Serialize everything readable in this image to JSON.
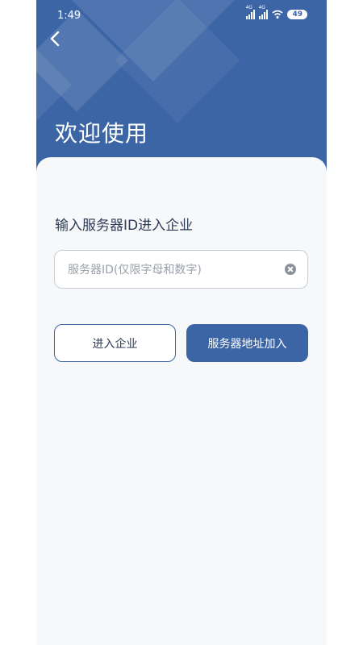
{
  "status_bar": {
    "time": "1:49",
    "sim1_type": "4G",
    "sim2_type": "4G",
    "battery": "49"
  },
  "header": {
    "title": "欢迎使用"
  },
  "form": {
    "label": "输入服务器ID进入企业",
    "id_field": {
      "value": "",
      "placeholder": "服务器ID(仅限字母和数字)"
    }
  },
  "buttons": {
    "enter_label": "进入企业",
    "server_label": "服务器地址加入"
  },
  "colors": {
    "brand": "#3c65a6",
    "background": "#f7f8fa"
  }
}
